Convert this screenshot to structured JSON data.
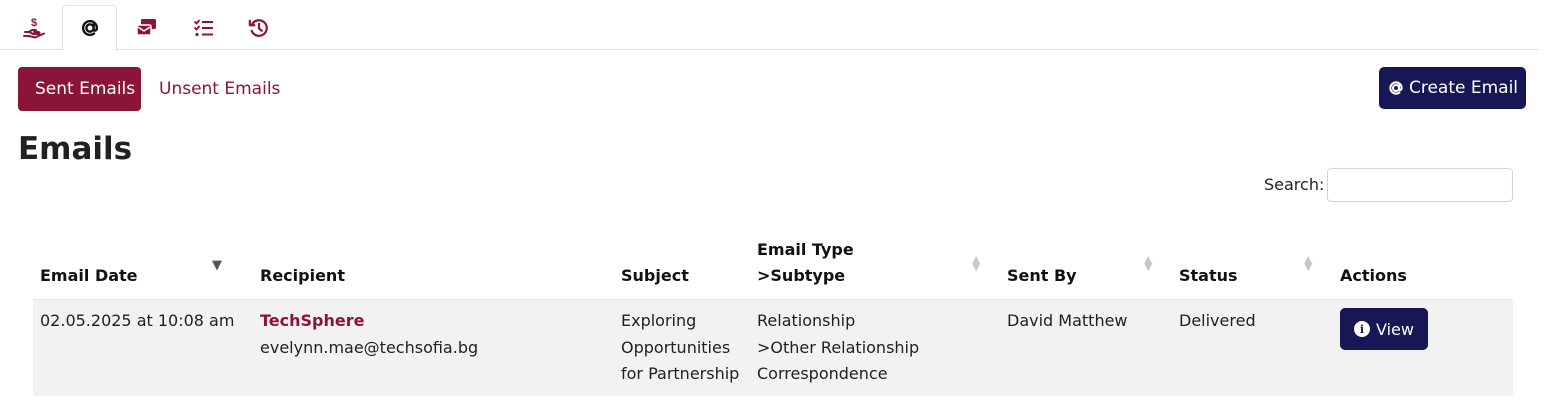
{
  "colors": {
    "brand": "#8b1538",
    "primary_dark": "#171756",
    "row_bg": "#f2f2f2"
  },
  "icon_tabs": [
    {
      "icon": "hand-dollar-icon",
      "active": false
    },
    {
      "icon": "at-sign-icon",
      "active": true
    },
    {
      "icon": "email-stack-icon",
      "active": false
    },
    {
      "icon": "checklist-icon",
      "active": false
    },
    {
      "icon": "history-icon",
      "active": false
    }
  ],
  "sub_tabs": {
    "sent": "Sent Emails",
    "unsent": "Unsent Emails"
  },
  "create_button": {
    "icon": "at-sign-icon",
    "label": "Create Email"
  },
  "page_title": "Emails",
  "search": {
    "label": "Search:",
    "value": ""
  },
  "table": {
    "headers": {
      "email_date": "Email Date",
      "recipient": "Recipient",
      "subject": "Subject",
      "email_type_line1": "Email Type",
      "email_type_line2": ">Subtype",
      "sent_by": "Sent By",
      "status": "Status",
      "actions": "Actions"
    },
    "rows": [
      {
        "email_date": "02.05.2025 at 10:08 am",
        "recipient_name": "TechSphere",
        "recipient_email": "evelynn.mae@techsofia.bg",
        "subject_lines": [
          "Exploring",
          "Opportunities",
          "for Partnership"
        ],
        "type_lines": [
          "Relationship",
          ">Other Relationship",
          "Correspondence"
        ],
        "sent_by": "David Matthew",
        "status": "Delivered",
        "action_label": "View",
        "action_icon": "info-circle-icon"
      }
    ]
  }
}
